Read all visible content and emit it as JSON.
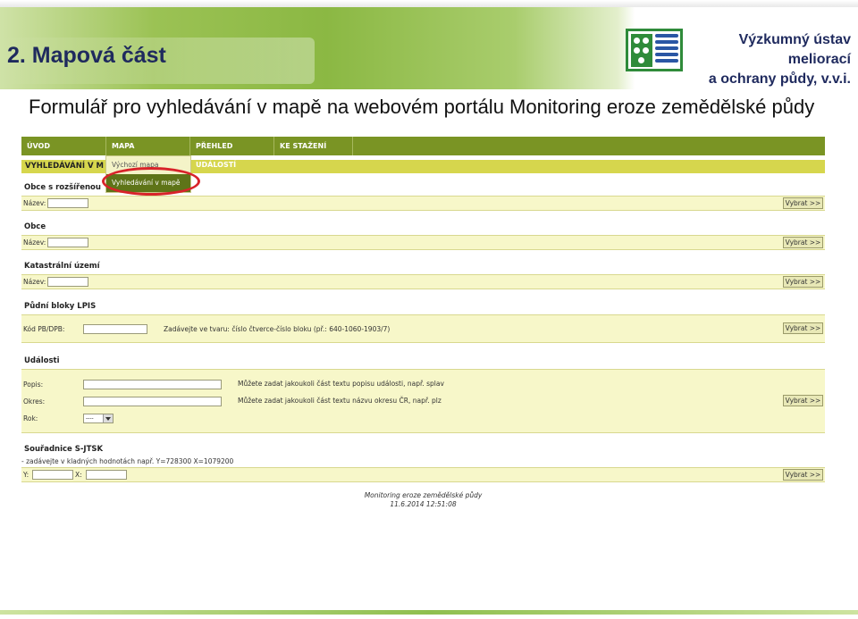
{
  "slide": {
    "title": "2. Mapová část",
    "institute_line1": "Výzkumný ústav meliorací",
    "institute_line2": "a ochrany půdy, v.v.i.",
    "subtitle": "Formulář pro vyhledávání v mapě na webovém portálu Monitoring eroze zemědělské půdy"
  },
  "nav": {
    "items": [
      {
        "label": "ÚVOD"
      },
      {
        "label": "MAPA"
      },
      {
        "label": "PŘEHLED UDÁLOSTÍ"
      },
      {
        "label": "KE STAŽENÍ"
      }
    ],
    "dropdown": [
      {
        "label": "Výchozí mapa"
      },
      {
        "label": "Vyhledávání v mapě"
      }
    ]
  },
  "breadcrumb": "VYHLEDÁVÁNÍ V M",
  "sections": {
    "obce_rozsirenou": {
      "title": "Obce s rozšířenou",
      "label": "Název:",
      "button": "Vybrat >>"
    },
    "obce": {
      "title": "Obce",
      "label": "Název:",
      "button": "Vybrat >>"
    },
    "katastralni": {
      "title": "Katastrální území",
      "label": "Název:",
      "button": "Vybrat >>"
    },
    "lpis": {
      "title": "Půdní bloky LPIS",
      "label": "Kód PB/DPB:",
      "hint": "Zadávejte ve tvaru: číslo čtverce-číslo bloku (př.: 640-1060-1903/7)",
      "button": "Vybrat >>"
    },
    "udalosti": {
      "title": "Události",
      "popis_label": "Popis:",
      "popis_hint": "Můžete zadat jakoukoli část textu popisu události, např. splav",
      "okres_label": "Okres:",
      "okres_hint": "Můžete zadat jakoukoli část textu názvu okresu ČR, např. plz",
      "rok_label": "Rok:",
      "rok_value": "----",
      "button": "Vybrat >>"
    },
    "sjtsk": {
      "title": "Souřadnice S-JTSK",
      "hint": "- zadávejte v kladných hodnotách např. Y=728300 X=1079200",
      "y_label": "Y:",
      "x_label": "X:",
      "button": "Vybrat >>"
    }
  },
  "footer": {
    "line1": "Monitoring eroze zemědělské půdy",
    "line2": "11.6.2014 12:51:08"
  }
}
